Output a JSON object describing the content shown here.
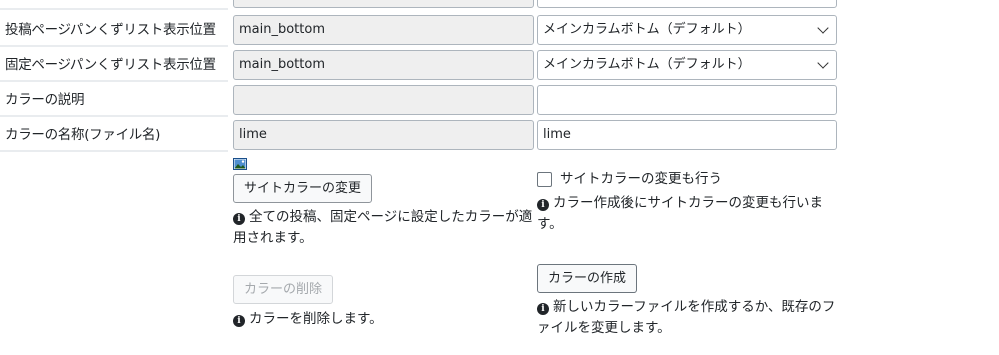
{
  "rows": [
    {
      "label": "投稿ページパンくずリスト表示位置",
      "current": "main_bottom",
      "select": "メインカラムボトム（デフォルト）"
    },
    {
      "label": "固定ページパンくずリスト表示位置",
      "current": "main_bottom",
      "select": "メインカラムボトム（デフォルト）"
    },
    {
      "label": "カラーの説明",
      "current": "",
      "value": ""
    },
    {
      "label": "カラーの名称(ファイル名)",
      "current": "lime",
      "value": "lime"
    }
  ],
  "actions": {
    "change_site_color": {
      "button": "サイトカラーの変更",
      "note": "全ての投稿、固定ページに設定したカラーが適用されます。"
    },
    "delete_color": {
      "button": "カラーの削除",
      "note": "カラーを削除します。"
    },
    "also_change_site_color": {
      "label": "サイトカラーの変更も行う",
      "checked": false,
      "note": "カラー作成後にサイトカラーの変更も行います。"
    },
    "create_color": {
      "button": "カラーの作成",
      "note": "新しいカラーファイルを作成するか、既存のファイルを変更します。"
    }
  },
  "icons": {
    "info": "info-icon",
    "image": "image-icon",
    "chevron": "chevron-down-icon"
  },
  "colors": {
    "readonly_bg": "#efefef",
    "border": "#adb5bd",
    "divider": "#e9ecef"
  }
}
